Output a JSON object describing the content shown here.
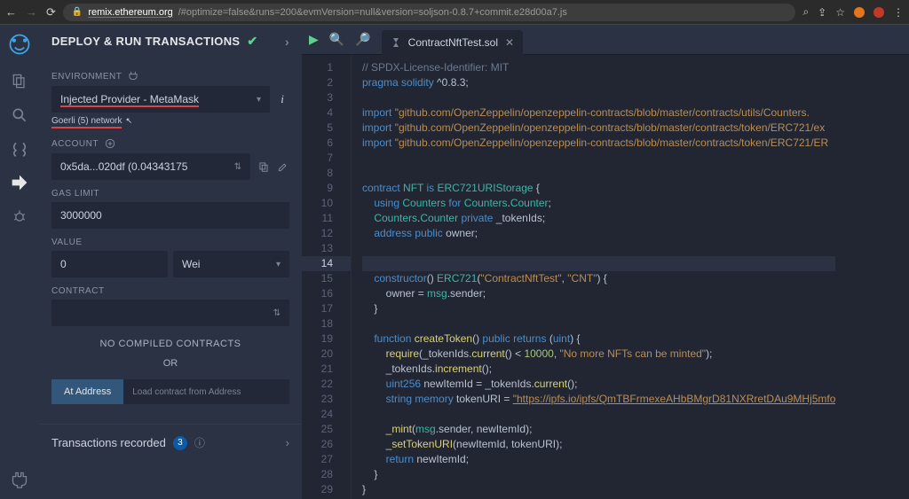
{
  "browser": {
    "url_host": "remix.ethereum.org",
    "url_path": "/#optimize=false&runs=200&evmVersion=null&version=soljson-0.8.7+commit.e28d00a7.js"
  },
  "panel": {
    "title": "DEPLOY & RUN TRANSACTIONS",
    "environment_label": "ENVIRONMENT",
    "environment_value": "Injected Provider - MetaMask",
    "network_badge": "Goerli (5) network",
    "account_label": "ACCOUNT",
    "account_value": "0x5da...020df (0.04343175",
    "gas_limit_label": "GAS LIMIT",
    "gas_limit_value": "3000000",
    "value_label": "VALUE",
    "value_amount": "0",
    "value_unit": "Wei",
    "contract_label": "CONTRACT",
    "no_compiled": "NO COMPILED CONTRACTS",
    "or": "OR",
    "at_address": "At Address",
    "load_placeholder": "Load contract from Address",
    "tx_recorded": "Transactions recorded",
    "tx_count": "3"
  },
  "editor": {
    "tab_name": "ContractNftTest.sol",
    "code": [
      {
        "n": 1,
        "h": "<span class='c-com'>// SPDX-License-Identifier: MIT</span>"
      },
      {
        "n": 2,
        "h": "<span class='c-kw'>pragma</span> <span class='c-kw'>solidity</span> ^0.8.3;"
      },
      {
        "n": 3,
        "h": ""
      },
      {
        "n": 4,
        "h": "<span class='c-kw'>import</span> <span class='c-str'>\"github.com/OpenZeppelin/openzeppelin-contracts/blob/master/contracts/utils/Counters.</span>"
      },
      {
        "n": 5,
        "h": "<span class='c-kw'>import</span> <span class='c-str'>\"github.com/OpenZeppelin/openzeppelin-contracts/blob/master/contracts/token/ERC721/ex</span>"
      },
      {
        "n": 6,
        "h": "<span class='c-kw'>import</span> <span class='c-str'>\"github.com/OpenZeppelin/openzeppelin-contracts/blob/master/contracts/token/ERC721/ER</span>"
      },
      {
        "n": 7,
        "h": ""
      },
      {
        "n": 8,
        "h": ""
      },
      {
        "n": 9,
        "h": "<span class='c-kw'>contract</span> <span class='c-type'>NFT</span> <span class='c-kw'>is</span> <span class='c-type'>ERC721URIStorage</span> {"
      },
      {
        "n": 10,
        "h": "    <span class='c-kw'>using</span> <span class='c-type'>Counters</span> <span class='c-kw'>for</span> <span class='c-type'>Counters</span>.<span class='c-type'>Counter</span>;"
      },
      {
        "n": 11,
        "h": "    <span class='c-type'>Counters</span>.<span class='c-type'>Counter</span> <span class='c-kw'>private</span> _tokenIds;"
      },
      {
        "n": 12,
        "h": "    <span class='c-kw'>address</span> <span class='c-kw'>public</span> owner;"
      },
      {
        "n": 13,
        "h": ""
      },
      {
        "n": 14,
        "h": "",
        "cur": true
      },
      {
        "n": 15,
        "h": "    <span class='c-kw'>constructor</span>() <span class='c-type'>ERC721</span>(<span class='c-str'>\"ContractNftTest\"</span>, <span class='c-str'>\"CNT\"</span>) {"
      },
      {
        "n": 16,
        "h": "        owner = <span class='c-type'>msg</span>.sender;"
      },
      {
        "n": 17,
        "h": "    }"
      },
      {
        "n": 18,
        "h": ""
      },
      {
        "n": 19,
        "h": "    <span class='c-kw'>function</span> <span class='c-fn'>createToken</span>() <span class='c-kw'>public</span> <span class='c-kw'>returns</span> (<span class='c-kw'>uint</span>) {"
      },
      {
        "n": 20,
        "h": "        <span class='c-fn'>require</span>(_tokenIds.<span class='c-fn'>current</span>() &lt; <span class='c-num'>10000</span>, <span class='c-str'>\"No more NFTs can be minted\"</span>);"
      },
      {
        "n": 21,
        "h": "        _tokenIds.<span class='c-fn'>increment</span>();"
      },
      {
        "n": 22,
        "h": "        <span class='c-kw'>uint256</span> newItemId = _tokenIds.<span class='c-fn'>current</span>();"
      },
      {
        "n": 23,
        "h": "        <span class='c-kw'>string</span> <span class='c-kw'>memory</span> tokenURI = <span class='c-str c-u'>\"https://ipfs.io/ipfs/QmTBFrmexeAHbBMgrD81NXRretDAu9MHj5mfo</span>"
      },
      {
        "n": 24,
        "h": ""
      },
      {
        "n": 25,
        "h": "        <span class='c-fn'>_mint</span>(<span class='c-type'>msg</span>.sender, newItemId);"
      },
      {
        "n": 26,
        "h": "        <span class='c-fn'>_setTokenURI</span>(newItemId, tokenURI);"
      },
      {
        "n": 27,
        "h": "        <span class='c-kw'>return</span> newItemId;"
      },
      {
        "n": 28,
        "h": "    }"
      },
      {
        "n": 29,
        "h": "}"
      }
    ]
  }
}
